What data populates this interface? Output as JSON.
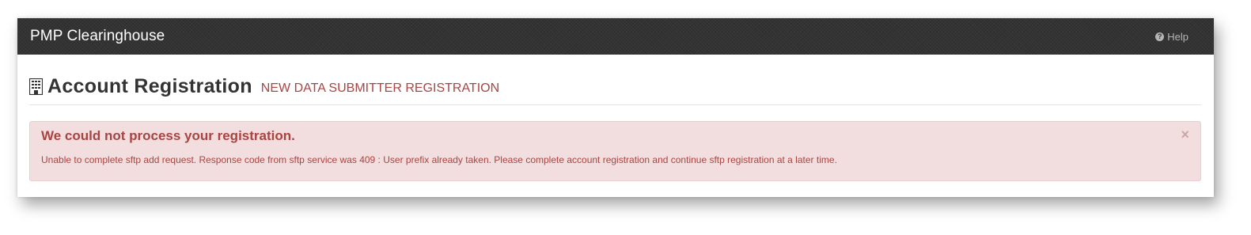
{
  "navbar": {
    "brand": "PMP Clearinghouse",
    "help_label": "Help",
    "help_icon": "question-circle-icon"
  },
  "page_header": {
    "icon": "building-icon",
    "title": "Account Registration",
    "subtitle": "NEW DATA SUBMITTER REGISTRATION"
  },
  "alert": {
    "heading": "We could not process your registration.",
    "message": "Unable to complete sftp add request. Response code from sftp service was 409 : User prefix already taken. Please complete account registration and continue sftp registration at a later time.",
    "close_label": "×"
  },
  "colors": {
    "navbar_bg": "#333333",
    "danger_text": "#a94442",
    "danger_bg": "#f2dede"
  }
}
